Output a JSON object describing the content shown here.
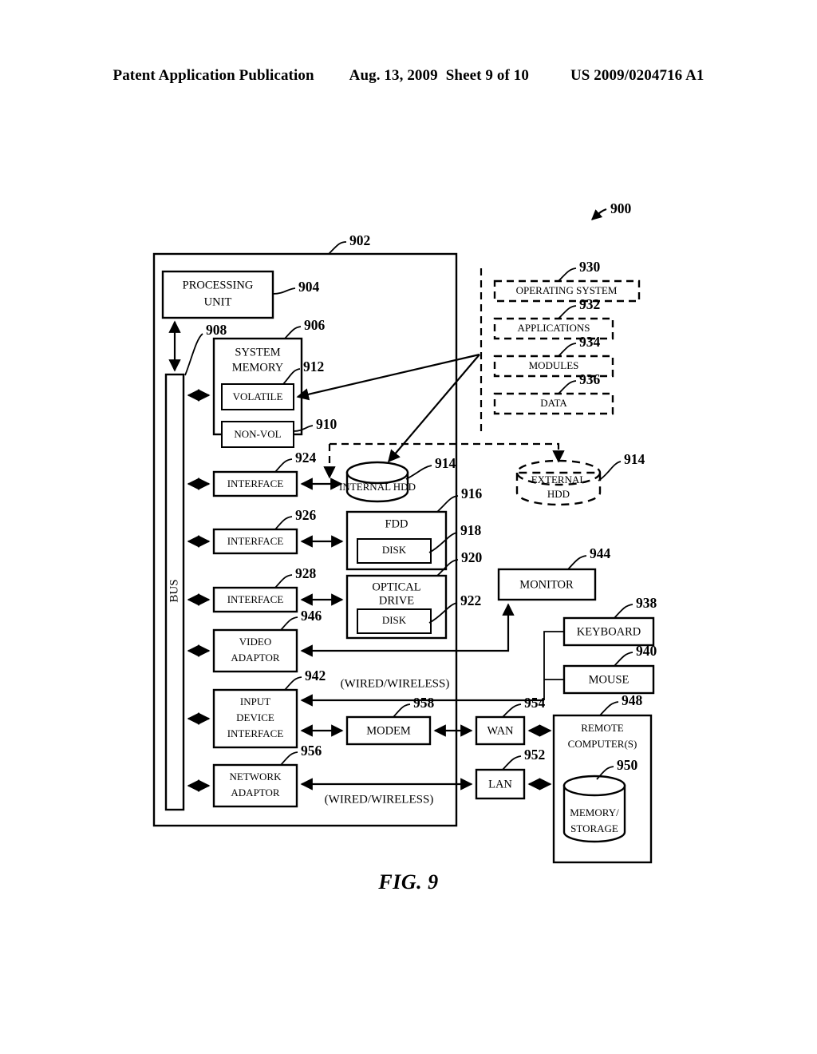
{
  "header": {
    "publication": "Patent Application Publication",
    "date": "Aug. 13, 2009",
    "sheet": "Sheet 9 of 10",
    "number": "US 2009/0204716 A1"
  },
  "figure": {
    "caption": "FIG. 9",
    "root_ref": "900"
  },
  "refs": {
    "r900": "900",
    "r902": "902",
    "r904": "904",
    "r906": "906",
    "r908": "908",
    "r910": "910",
    "r912": "912",
    "r914a": "914",
    "r914b": "914",
    "r916": "916",
    "r918": "918",
    "r920": "920",
    "r922": "922",
    "r924": "924",
    "r926": "926",
    "r928": "928",
    "r930": "930",
    "r932": "932",
    "r934": "934",
    "r936": "936",
    "r938": "938",
    "r940": "940",
    "r942": "942",
    "r944": "944",
    "r946": "946",
    "r948": "948",
    "r950": "950",
    "r952": "952",
    "r954": "954",
    "r956": "956",
    "r958": "958"
  },
  "blocks": {
    "processing_unit_l1": "PROCESSING",
    "processing_unit_l2": "UNIT",
    "bus": "BUS",
    "system_memory_l1": "SYSTEM",
    "system_memory_l2": "MEMORY",
    "volatile": "VOLATILE",
    "non_volatile": "NON-VOL",
    "interface_924": "INTERFACE",
    "interface_926": "INTERFACE",
    "interface_928": "INTERFACE",
    "internal_hdd": "INTERNAL HDD",
    "external_hdd_l1": "EXTERNAL",
    "external_hdd_l2": "HDD",
    "fdd": "FDD",
    "fdd_disk": "DISK",
    "optical_drive_l1": "OPTICAL",
    "optical_drive_l2": "DRIVE",
    "optical_disk": "DISK",
    "video_adaptor_l1": "VIDEO",
    "video_adaptor_l2": "ADAPTOR",
    "input_device_interface_l1": "INPUT",
    "input_device_interface_l2": "DEVICE",
    "input_device_interface_l3": "INTERFACE",
    "network_adaptor_l1": "NETWORK",
    "network_adaptor_l2": "ADAPTOR",
    "monitor": "MONITOR",
    "keyboard": "KEYBOARD",
    "mouse": "MOUSE",
    "modem": "MODEM",
    "wan": "WAN",
    "lan": "LAN",
    "remote_computers_l1": "REMOTE",
    "remote_computers_l2": "COMPUTER(S)",
    "memory_storage_l1": "MEMORY/",
    "memory_storage_l2": "STORAGE",
    "operating_system": "OPERATING SYSTEM",
    "applications": "APPLICATIONS",
    "modules": "MODULES",
    "data": "DATA",
    "wired_wireless_top": "(WIRED/WIRELESS)",
    "wired_wireless_bottom": "(WIRED/WIRELESS)"
  }
}
